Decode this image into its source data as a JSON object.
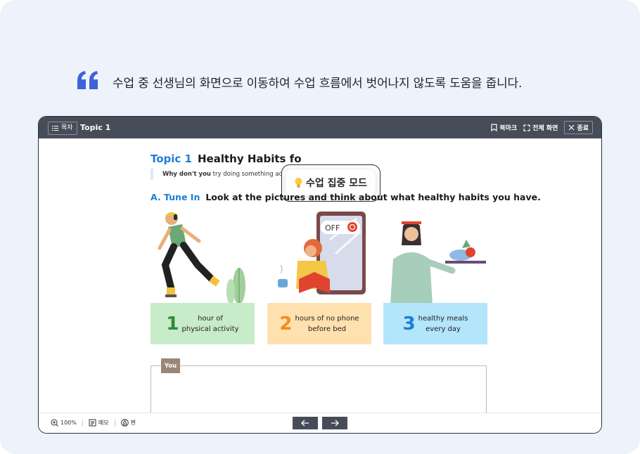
{
  "headline": "수업 중 선생님의 화면으로 이동하여 수업 흐름에서 벗어나지 않도록 도움을 줍니다.",
  "colors": {
    "accent_blue": "#3d63d9",
    "topbar": "#464c58",
    "topic_blue": "#1c7ed6",
    "card1": "#c8ebc9",
    "card2": "#ffe1b0",
    "card3": "#b3e5fb",
    "num1": "#2e8b3a",
    "num2": "#f28c1a",
    "num3": "#1c7ed6"
  },
  "topbar": {
    "toc_label": "목차",
    "topic": "Topic 1",
    "bookmark_label": "북마크",
    "fullscreen_label": "전체 화면",
    "close_label": "종료"
  },
  "lesson": {
    "topic_label": "Topic 1",
    "topic_name": "Healthy Habits fo",
    "sub_bold": "Why don't you",
    "sub_rest": " try doing something acti",
    "focus_mode": "수업 집중 모드",
    "section_label": "A. Tune In",
    "section_text": "Look at the pictures and think about what healthy habits you have.",
    "phone_off": "OFF",
    "cards": [
      {
        "number": "1",
        "line1": "hour of",
        "line2": "physical activity"
      },
      {
        "number": "2",
        "line1": "hours of no phone",
        "line2": "before bed"
      },
      {
        "number": "3",
        "line1": "healthy meals",
        "line2": "every day"
      }
    ],
    "you_tag": "You"
  },
  "bottombar": {
    "zoom": "100%",
    "memo_label": "메모",
    "pen_label": "펜"
  },
  "icons": {
    "quote": "quote-icon",
    "toc": "list-icon",
    "bookmark": "bookmark-icon",
    "fullscreen": "fullscreen-icon",
    "close": "close-icon",
    "bulb": "lightbulb-icon",
    "zoom": "zoom-icon",
    "memo": "memo-icon",
    "pen": "pen-icon",
    "prev": "arrow-left-icon",
    "next": "arrow-right-icon"
  }
}
